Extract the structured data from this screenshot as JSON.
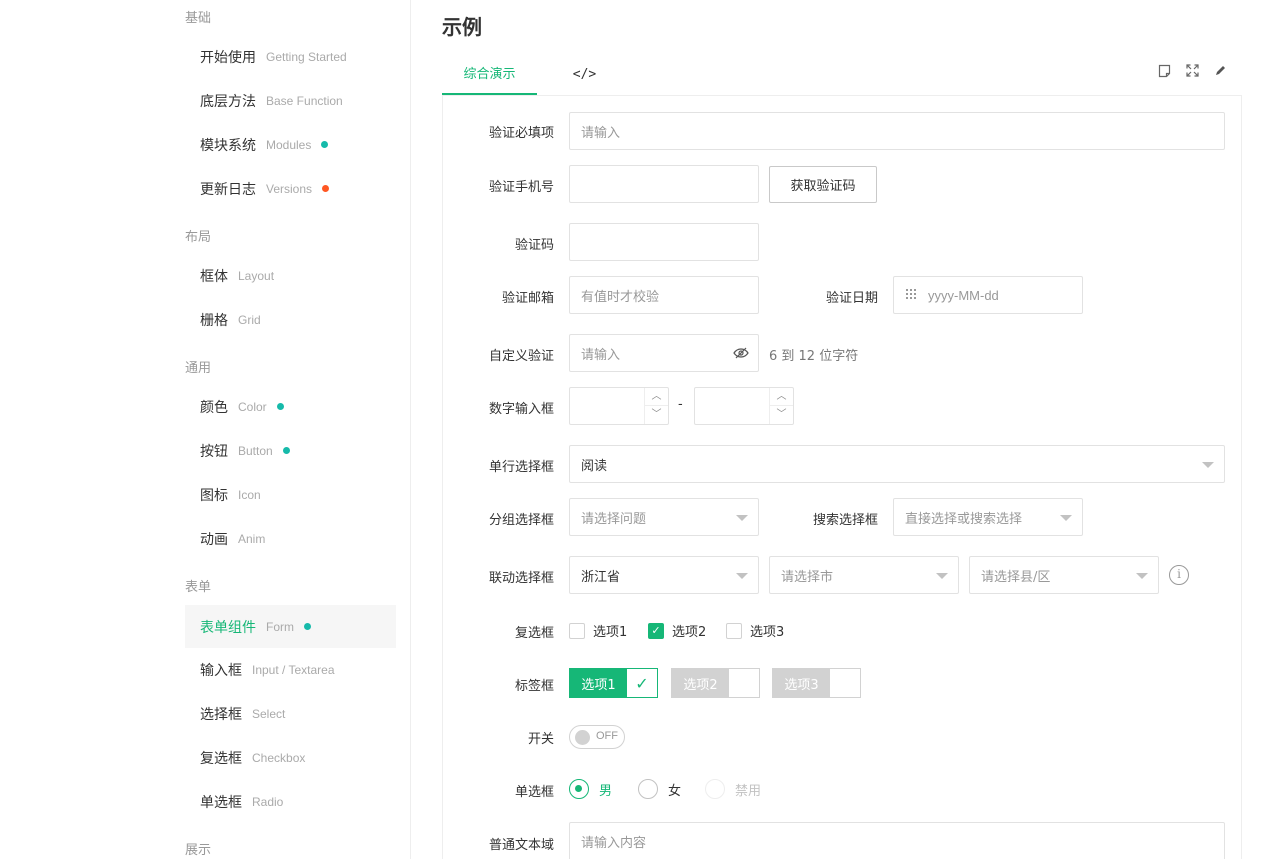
{
  "sidebar": {
    "groups": [
      {
        "title": "基础"
      },
      {
        "title": "布局"
      },
      {
        "title": "通用"
      },
      {
        "title": "表单"
      },
      {
        "title": "展示"
      }
    ],
    "items": [
      {
        "zh": "开始使用",
        "en": "Getting Started"
      },
      {
        "zh": "底层方法",
        "en": "Base Function"
      },
      {
        "zh": "模块系统",
        "en": "Modules"
      },
      {
        "zh": "更新日志",
        "en": "Versions"
      },
      {
        "zh": "框体",
        "en": "Layout"
      },
      {
        "zh": "栅格",
        "en": "Grid"
      },
      {
        "zh": "颜色",
        "en": "Color"
      },
      {
        "zh": "按钮",
        "en": "Button"
      },
      {
        "zh": "图标",
        "en": "Icon"
      },
      {
        "zh": "动画",
        "en": "Anim"
      },
      {
        "zh": "表单组件",
        "en": "Form"
      },
      {
        "zh": "输入框",
        "en": "Input / Textarea"
      },
      {
        "zh": "选择框",
        "en": "Select"
      },
      {
        "zh": "复选框",
        "en": "Checkbox"
      },
      {
        "zh": "单选框",
        "en": "Radio"
      }
    ]
  },
  "page": {
    "title": "示例"
  },
  "tabs": {
    "demo": "综合演示",
    "code": "</>"
  },
  "toolbar": {
    "note_icon": "note-icon",
    "fullscreen_icon": "fullscreen-icon",
    "edit_icon": "edit-icon"
  },
  "form": {
    "required": {
      "label": "验证必填项",
      "placeholder": "请输入"
    },
    "phone": {
      "label": "验证手机号",
      "button": "获取验证码"
    },
    "code": {
      "label": "验证码"
    },
    "email": {
      "label": "验证邮箱",
      "placeholder": "有值时才校验"
    },
    "date": {
      "label": "验证日期",
      "placeholder": "yyyy-MM-dd"
    },
    "custom": {
      "label": "自定义验证",
      "placeholder": "请输入",
      "hint": "6 到 12 位字符"
    },
    "number": {
      "label": "数字输入框",
      "separator": "-"
    },
    "single_select": {
      "label": "单行选择框",
      "value": "阅读"
    },
    "group_select": {
      "label": "分组选择框",
      "placeholder": "请选择问题"
    },
    "search_select": {
      "label": "搜索选择框",
      "placeholder": "直接选择或搜索选择"
    },
    "linked_select": {
      "label": "联动选择框",
      "province": "浙江省",
      "city": "请选择市",
      "district": "请选择县/区"
    },
    "checkbox": {
      "label": "复选框",
      "options": [
        "选项1",
        "选项2",
        "选项3"
      ],
      "checked": [
        false,
        true,
        false
      ]
    },
    "tag_checkbox": {
      "label": "标签框",
      "options": [
        "选项1",
        "选项2",
        "选项3"
      ],
      "checked": [
        true,
        false,
        false
      ]
    },
    "switch": {
      "label": "开关",
      "state": "OFF"
    },
    "radio": {
      "label": "单选框",
      "options": [
        "男",
        "女",
        "禁用"
      ],
      "selected": "男"
    },
    "textarea": {
      "label": "普通文本域",
      "placeholder": "请输入内容"
    }
  },
  "colors": {
    "accent": "#16b777",
    "teal_dot": "#16baaa",
    "red_dot": "#ff5722"
  }
}
